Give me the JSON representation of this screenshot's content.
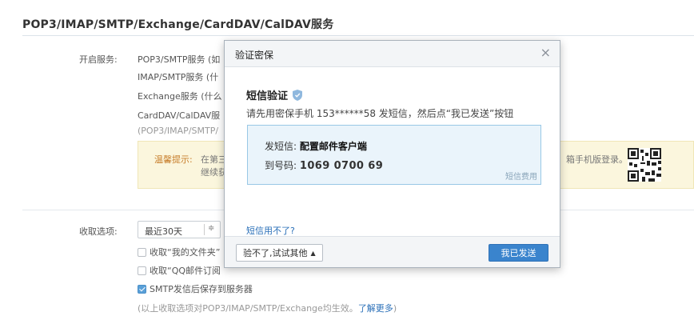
{
  "page": {
    "title": "POP3/IMAP/SMTP/Exchange/CardDAV/CalDAV服务"
  },
  "services": {
    "label": "开启服务:",
    "items": [
      "POP3/SMTP服务 (如",
      "IMAP/SMTP服务 (什",
      "Exchange服务 (什么",
      "CardDAV/CalDAV服"
    ],
    "note": "(POP3/IMAP/SMTP/"
  },
  "tips": {
    "label": "温馨提示:",
    "text1": "在第三",
    "text2": "继续获",
    "text_right": "箱手机版登录。"
  },
  "receive": {
    "label": "收取选项:",
    "select_value": "最近30天",
    "select_arrow": "≑",
    "options": [
      {
        "label": "收取“我的文件夹”",
        "checked": false
      },
      {
        "label": "收取“QQ邮件订阅",
        "checked": false
      },
      {
        "label": "SMTP发信后保存到服务器",
        "checked": true
      }
    ],
    "footnote": "(以上收取选项对POP3/IMAP/SMTP/Exchange均生效。",
    "footnote_link": "了解更多",
    "footnote_end": ")"
  },
  "dialog": {
    "title": "验证密保",
    "close": "×",
    "sms_title": "短信验证",
    "description": "请先用密保手机 153******58 发短信，然后点“我已发送”按钮",
    "send_label": "发短信:",
    "send_content": "配置邮件客户端",
    "to_label": "到号码:",
    "to_number": "1069 0700 69",
    "fee": "短信费用",
    "help_link": "短信用不了?",
    "alt_button": "验不了,试试其他",
    "alt_arrow": "▲",
    "confirm_button": "我已发送"
  },
  "colors": {
    "accent": "#3a84cd",
    "link": "#2a6fb8",
    "tips_bg": "#fbf6dd",
    "sms_box_bg": "#eaf4fb"
  }
}
